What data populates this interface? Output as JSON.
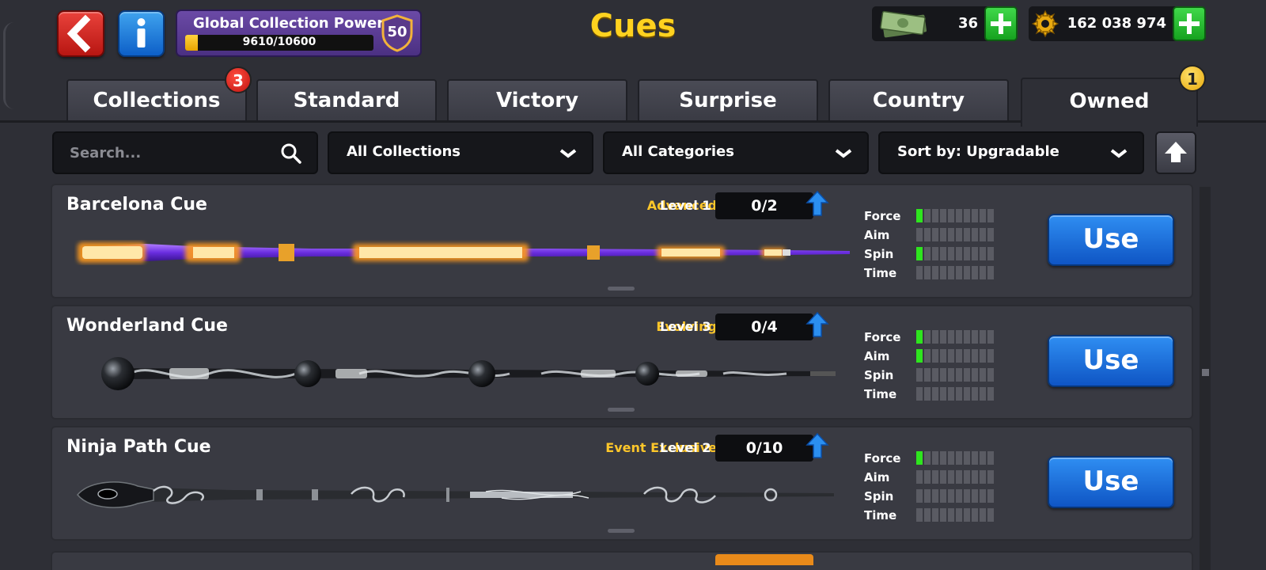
{
  "header": {
    "title": "Cues",
    "global_collection_power": {
      "label": "Global Collection Power",
      "value_text": "9610/10600",
      "progress_fraction": 0.066,
      "level": "50"
    },
    "cash": "36",
    "coins": "162 038 974"
  },
  "tabs": [
    {
      "label": "Collections",
      "badge": "3"
    },
    {
      "label": "Standard"
    },
    {
      "label": "Victory"
    },
    {
      "label": "Surprise"
    },
    {
      "label": "Country"
    },
    {
      "label": "Owned",
      "badge": "1",
      "active": true
    }
  ],
  "filters": {
    "search_placeholder": "Search...",
    "collection": "All Collections",
    "category": "All Categories",
    "sort": "Sort by: Upgradable"
  },
  "stat_labels": [
    "Force",
    "Aim",
    "Spin",
    "Time"
  ],
  "cues": [
    {
      "name": "Barcelona Cue",
      "category": "Advanced",
      "level": "Level 1",
      "progress": "0/2",
      "stats": {
        "force": 1,
        "aim": 0,
        "spin": 1,
        "time": 0
      },
      "use_label": "Use"
    },
    {
      "name": "Wonderland Cue",
      "category": "Evolving",
      "level": "Level 3",
      "progress": "0/4",
      "stats": {
        "force": 1,
        "aim": 1,
        "spin": 0,
        "time": 0
      },
      "use_label": "Use"
    },
    {
      "name": "Ninja Path Cue",
      "category": "Event Exclusive",
      "level": "Level 2",
      "progress": "0/10",
      "stats": {
        "force": 1,
        "aim": 0,
        "spin": 0,
        "time": 0
      },
      "use_label": "Use"
    }
  ],
  "stat_max": 10,
  "colors": {
    "accent_yellow": "#ffd21f",
    "category_yellow": "#ffc72a",
    "use_button_blue": "#1f6fdc",
    "stat_on_green": "#2ee51e",
    "plus_green": "#2bc135",
    "back_red": "#d42a24"
  },
  "icons": {
    "back": "chevron-left-icon",
    "info": "info-icon",
    "search": "search-icon",
    "dropdown": "chevron-down-icon",
    "sort_direction": "arrow-up-icon",
    "upgrade": "arrow-up-icon",
    "cash": "cash-icon",
    "coins": "coin-icon",
    "add": "plus-icon"
  }
}
